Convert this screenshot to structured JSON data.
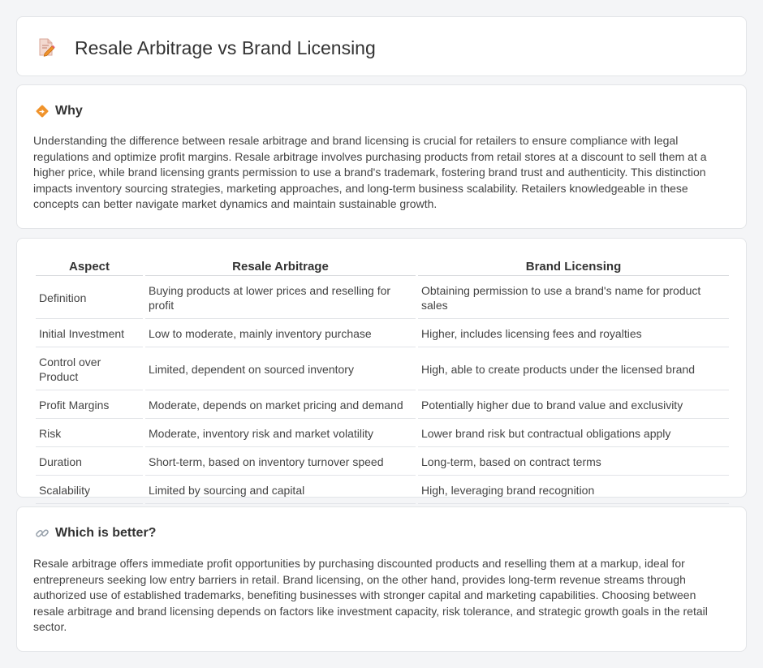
{
  "header": {
    "title": "Resale Arbitrage vs Brand Licensing",
    "icon": "document-pencil-icon"
  },
  "why": {
    "icon": "diamond-warning-icon",
    "title": "Why",
    "body": "Understanding the difference between resale arbitrage and brand licensing is crucial for retailers to ensure compliance with legal regulations and optimize profit margins. Resale arbitrage involves purchasing products from retail stores at a discount to sell them at a higher price, while brand licensing grants permission to use a brand's trademark, fostering brand trust and authenticity. This distinction impacts inventory sourcing strategies, marketing approaches, and long-term business scalability. Retailers knowledgeable in these concepts can better navigate market dynamics and maintain sustainable growth."
  },
  "comparison": {
    "headers": [
      "Aspect",
      "Resale Arbitrage",
      "Brand Licensing"
    ],
    "rows": [
      [
        "Definition",
        "Buying products at lower prices and reselling for profit",
        "Obtaining permission to use a brand's name for product sales"
      ],
      [
        "Initial Investment",
        "Low to moderate, mainly inventory purchase",
        "Higher, includes licensing fees and royalties"
      ],
      [
        "Control over Product",
        "Limited, dependent on sourced inventory",
        "High, able to create products under the licensed brand"
      ],
      [
        "Profit Margins",
        "Moderate, depends on market pricing and demand",
        "Potentially higher due to brand value and exclusivity"
      ],
      [
        "Risk",
        "Moderate, inventory risk and market volatility",
        "Lower brand risk but contractual obligations apply"
      ],
      [
        "Duration",
        "Short-term, based on inventory turnover speed",
        "Long-term, based on contract terms"
      ],
      [
        "Scalability",
        "Limited by sourcing and capital",
        "High, leveraging brand recognition"
      ]
    ]
  },
  "better": {
    "icon": "link-icon",
    "title": "Which is better?",
    "body": "Resale arbitrage offers immediate profit opportunities by purchasing discounted products and reselling them at a markup, ideal for entrepreneurs seeking low entry barriers in retail. Brand licensing, on the other hand, provides long-term revenue streams through authorized use of established trademarks, benefiting businesses with stronger capital and marketing capabilities. Choosing between resale arbitrage and brand licensing depends on factors like investment capacity, risk tolerance, and strategic growth goals in the retail sector."
  },
  "colors": {
    "page_background": "#f4f5f7",
    "card_background": "#ffffff",
    "accent_orange": "#f0932b",
    "icon_pink": "#e8607a"
  }
}
